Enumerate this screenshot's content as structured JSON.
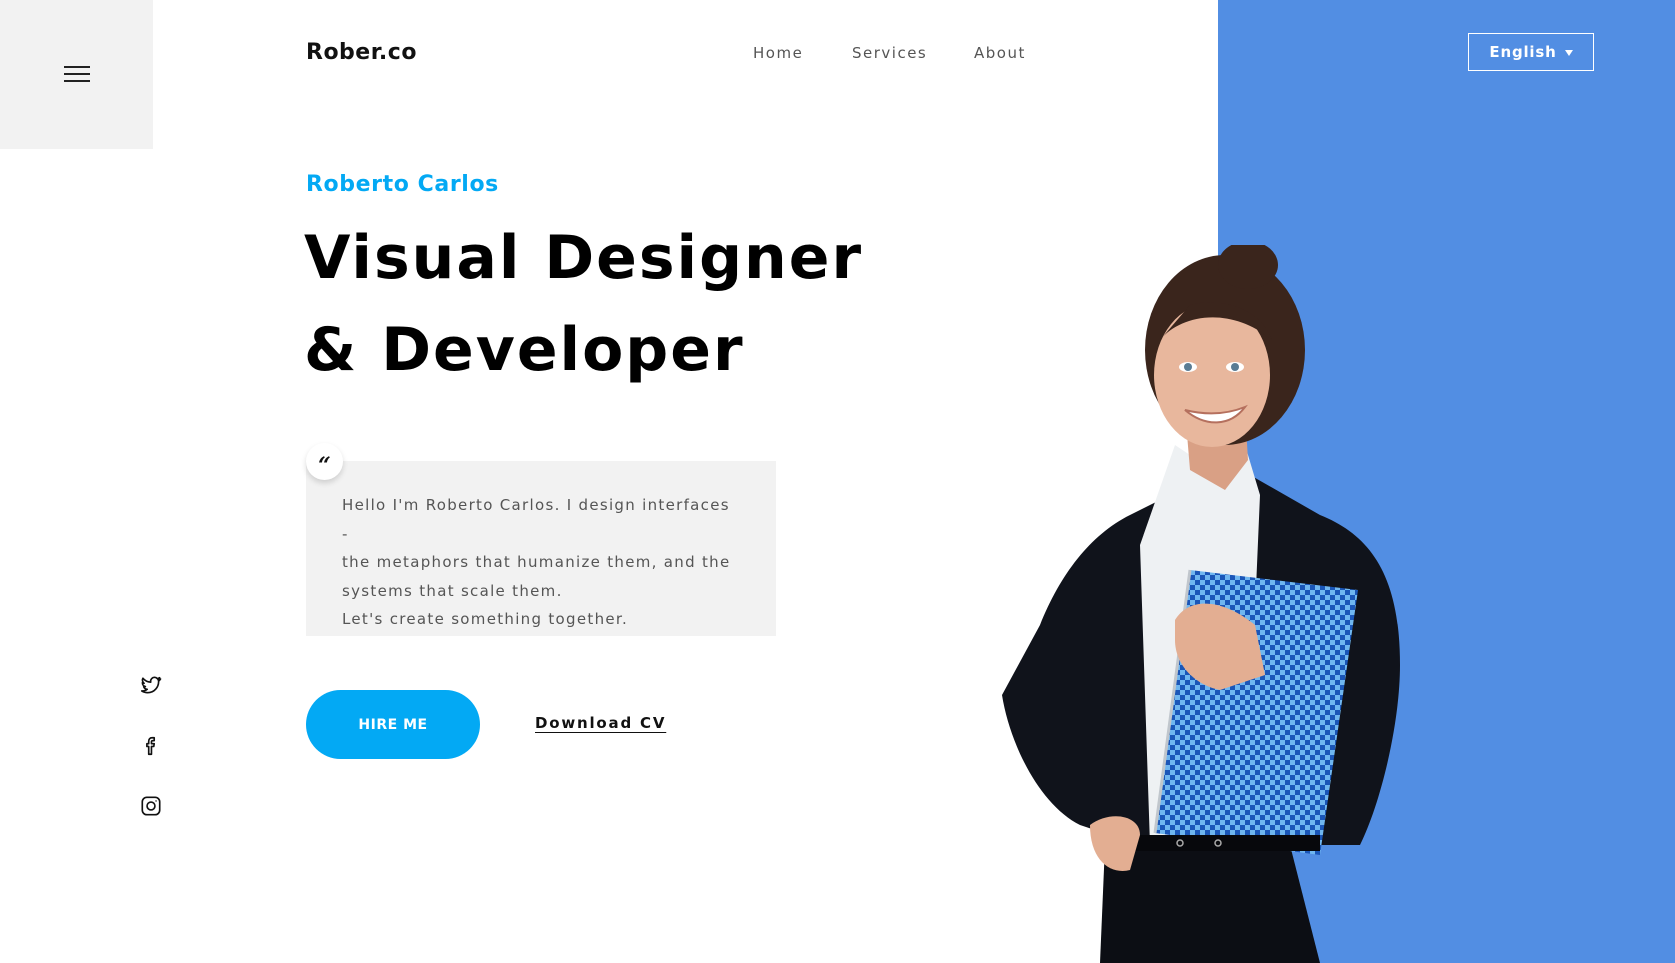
{
  "header": {
    "logo": "Rober.co",
    "nav": [
      {
        "label": "Home"
      },
      {
        "label": "Services"
      },
      {
        "label": "About"
      }
    ],
    "language": {
      "selected": "English"
    }
  },
  "hero": {
    "subtitle": "Roberto Carlos",
    "headline_line1": "Visual Designer",
    "headline_line2": "& Developer",
    "quote": {
      "mark": "“",
      "lines": [
        "Hello I'm Roberto Carlos. I design interfaces -",
        "the metaphors that humanize them, and the",
        "systems that scale them.",
        "Let's create something together."
      ]
    },
    "hire_label": "HIRE ME",
    "cv_label": "Download CV",
    "image_description": "Smiling woman in black blazer holding blue notebook"
  },
  "social": [
    {
      "icon": "twitter-icon"
    },
    {
      "icon": "facebook-icon"
    },
    {
      "icon": "instagram-icon"
    }
  ],
  "colors": {
    "accent": "#03a9f4",
    "panel_blue": "#528ee3",
    "menu_bg": "#f2f2f2",
    "quote_bg": "#f2f2f2"
  }
}
